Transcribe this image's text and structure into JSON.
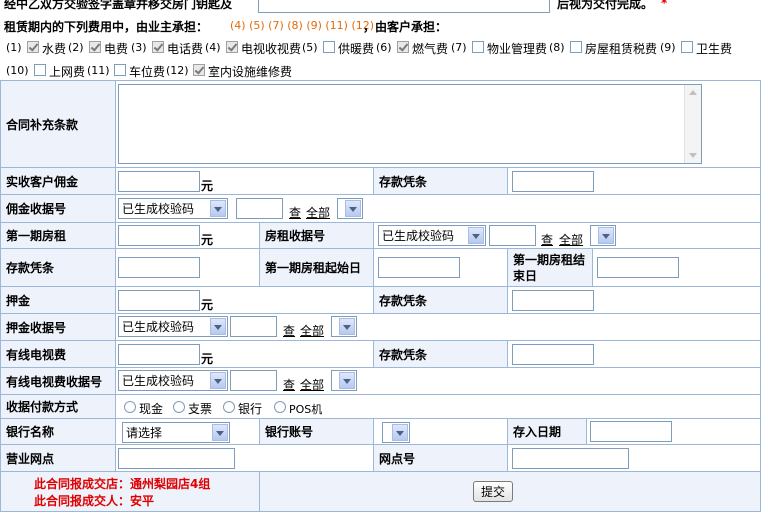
{
  "top": {
    "line1_prefix": "经中乙双方交验签字盖章并移交房门钥匙及",
    "line1_suffix": "后视为交付完成。",
    "required_mark": "*",
    "fees_intro": "租赁期内的下列费用中，由业主承担：",
    "fees_numbers": "(4) (5) (7) (8) (9) (11) (12)",
    "fees_tail": "，由客户承担："
  },
  "fees": [
    {
      "num": "(1)",
      "label": "水费",
      "checked": true
    },
    {
      "num": "(2)",
      "label": "电费",
      "checked": true
    },
    {
      "num": "(3)",
      "label": "电话费",
      "checked": true
    },
    {
      "num": "(4)",
      "label": "电视收视费",
      "checked": true
    },
    {
      "num": "(5)",
      "label": "供暖费",
      "checked": false
    },
    {
      "num": "(6)",
      "label": "燃气费",
      "checked": true
    },
    {
      "num": "(7)",
      "label": "物业管理费",
      "checked": false
    },
    {
      "num": "(8)",
      "label": "房屋租赁税费",
      "checked": false
    },
    {
      "num": "(9)",
      "label": "卫生费",
      "checked": false
    },
    {
      "num": "(10)",
      "label": "上网费",
      "checked": false
    },
    {
      "num": "(11)",
      "label": "车位费",
      "checked": false
    },
    {
      "num": "(12)",
      "label": "室内设施维修费",
      "checked": true
    }
  ],
  "supplement": {
    "label": "合同补充条款",
    "value": ""
  },
  "labels": {
    "commission": "实收客户佣金",
    "deposit_voucher": "存款凭条",
    "commission_receipt": "佣金收据号",
    "first_rent": "第一期房租",
    "rent_receipt": "房租收据号",
    "first_rent_start": "第一期房租起始日",
    "first_rent_end": "第一期房租结束日",
    "pledge": "押金",
    "pledge_receipt": "押金收据号",
    "cable_fee": "有线电视费",
    "cable_receipt": "有线电视费收据号",
    "payment_method": "收据付款方式",
    "bank_name": "银行名称",
    "bank_account": "银行账号",
    "deposit_date": "存入日期",
    "branch": "营业网点",
    "branch_no": "网点号"
  },
  "unit_yuan": "元",
  "receipt_select": "已生成校验码",
  "check_link": "查",
  "all_link": "全部",
  "payment_options": [
    "现金",
    "支票",
    "银行",
    "POS机"
  ],
  "bank_select": "请选择",
  "footer": {
    "store": "此合同报成交店：通州梨园店4组",
    "person": "此合同报成交人：安平",
    "submit": "提交"
  }
}
